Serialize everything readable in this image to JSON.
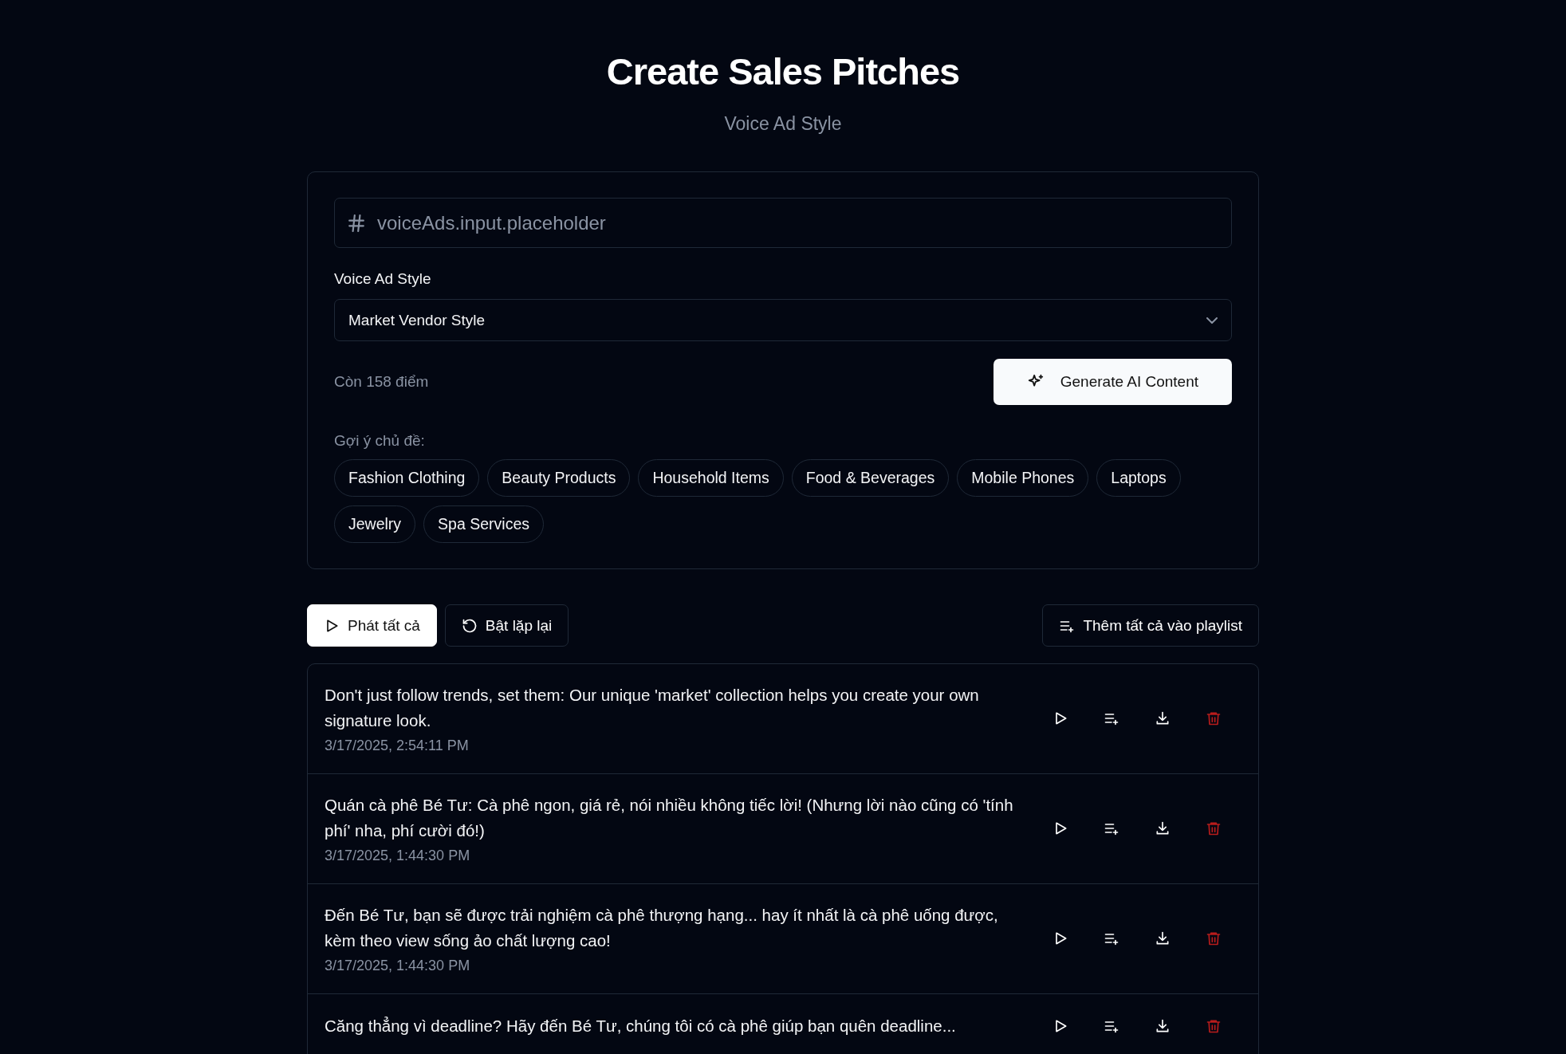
{
  "header": {
    "title": "Create Sales Pitches",
    "subtitle": "Voice Ad Style"
  },
  "form": {
    "input": {
      "placeholder": "voiceAds.input.placeholder"
    },
    "style_label": "Voice Ad Style",
    "style_select": {
      "value": "Market Vendor Style"
    },
    "credits": "Còn 158 điểm",
    "generate_button": "Generate AI Content",
    "suggestions_label": "Gợi ý chủ đề:",
    "suggestions": [
      "Fashion Clothing",
      "Beauty Products",
      "Household Items",
      "Food & Beverages",
      "Mobile Phones",
      "Laptops",
      "Jewelry",
      "Spa Services"
    ]
  },
  "toolbar": {
    "play_all": "Phát tất cả",
    "repeat": "Bật lặp lại",
    "add_all": "Thêm tất cả vào playlist"
  },
  "pitches": [
    {
      "text": "Don't just follow trends, set them: Our unique 'market' collection helps you create your own signature look.",
      "date": "3/17/2025, 2:54:11 PM"
    },
    {
      "text": "Quán cà phê Bé Tư: Cà phê ngon, giá rẻ, nói nhiều không tiếc lời! (Nhưng lời nào cũng có 'tính phí' nha, phí cười đó!)",
      "date": "3/17/2025, 1:44:30 PM"
    },
    {
      "text": "Đến Bé Tư, bạn sẽ được trải nghiệm cà phê thượng hạng... hay ít nhất là cà phê uống được, kèm theo view sống ảo chất lượng cao!",
      "date": "3/17/2025, 1:44:30 PM"
    },
    {
      "text": "Căng thẳng vì deadline? Hãy đến Bé Tư, chúng tôi có cà phê giúp bạn quên deadline..."
    }
  ]
}
